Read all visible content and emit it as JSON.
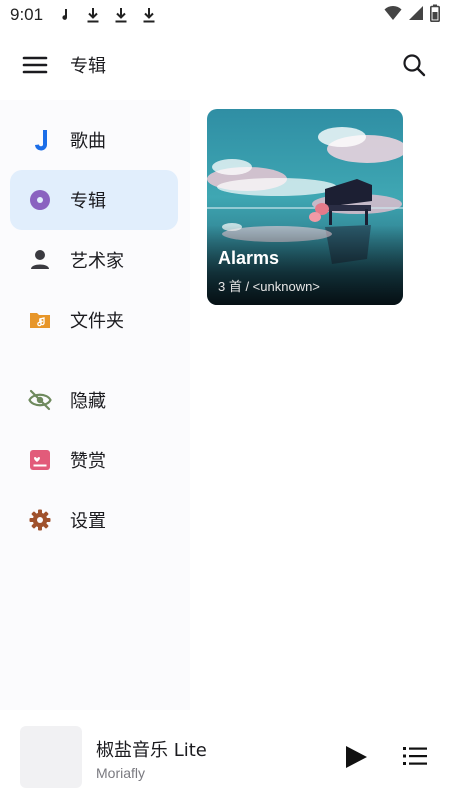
{
  "status_bar": {
    "time": "9:01",
    "left_icons": [
      "music-note-icon",
      "download-icon",
      "download-icon",
      "download-icon"
    ],
    "right_icons": [
      "wifi-icon",
      "signal-icon",
      "battery-icon"
    ]
  },
  "app_bar": {
    "title": "专辑",
    "menu_icon": "menu-icon",
    "search_icon": "search-icon"
  },
  "drawer": {
    "items": [
      {
        "label": "歌曲",
        "icon": "song-icon",
        "active": false,
        "color": "#1c6ee8"
      },
      {
        "label": "专辑",
        "icon": "album-icon",
        "active": true,
        "color": "#8a62c0"
      },
      {
        "label": "艺术家",
        "icon": "person-icon",
        "active": false,
        "color": "#3a3a40"
      },
      {
        "label": "文件夹",
        "icon": "folder-icon",
        "active": false,
        "color": "#e7962a"
      },
      {
        "label": "隐藏",
        "icon": "hidden-icon",
        "active": false,
        "color": "#6f8a5e"
      },
      {
        "label": "赞赏",
        "icon": "donate-icon",
        "active": false,
        "color": "#e25b7a"
      },
      {
        "label": "设置",
        "icon": "settings-icon",
        "active": false,
        "color": "#a0522d"
      }
    ]
  },
  "albums": [
    {
      "title": "Alarms",
      "subtitle": "3 首 / <unknown>"
    }
  ],
  "mini_player": {
    "title": "椒盐音乐 Lite",
    "artist": "Moriafly"
  },
  "colors": {
    "accent": "#1c6ee8",
    "active_item_bg": "#e1eefc"
  }
}
